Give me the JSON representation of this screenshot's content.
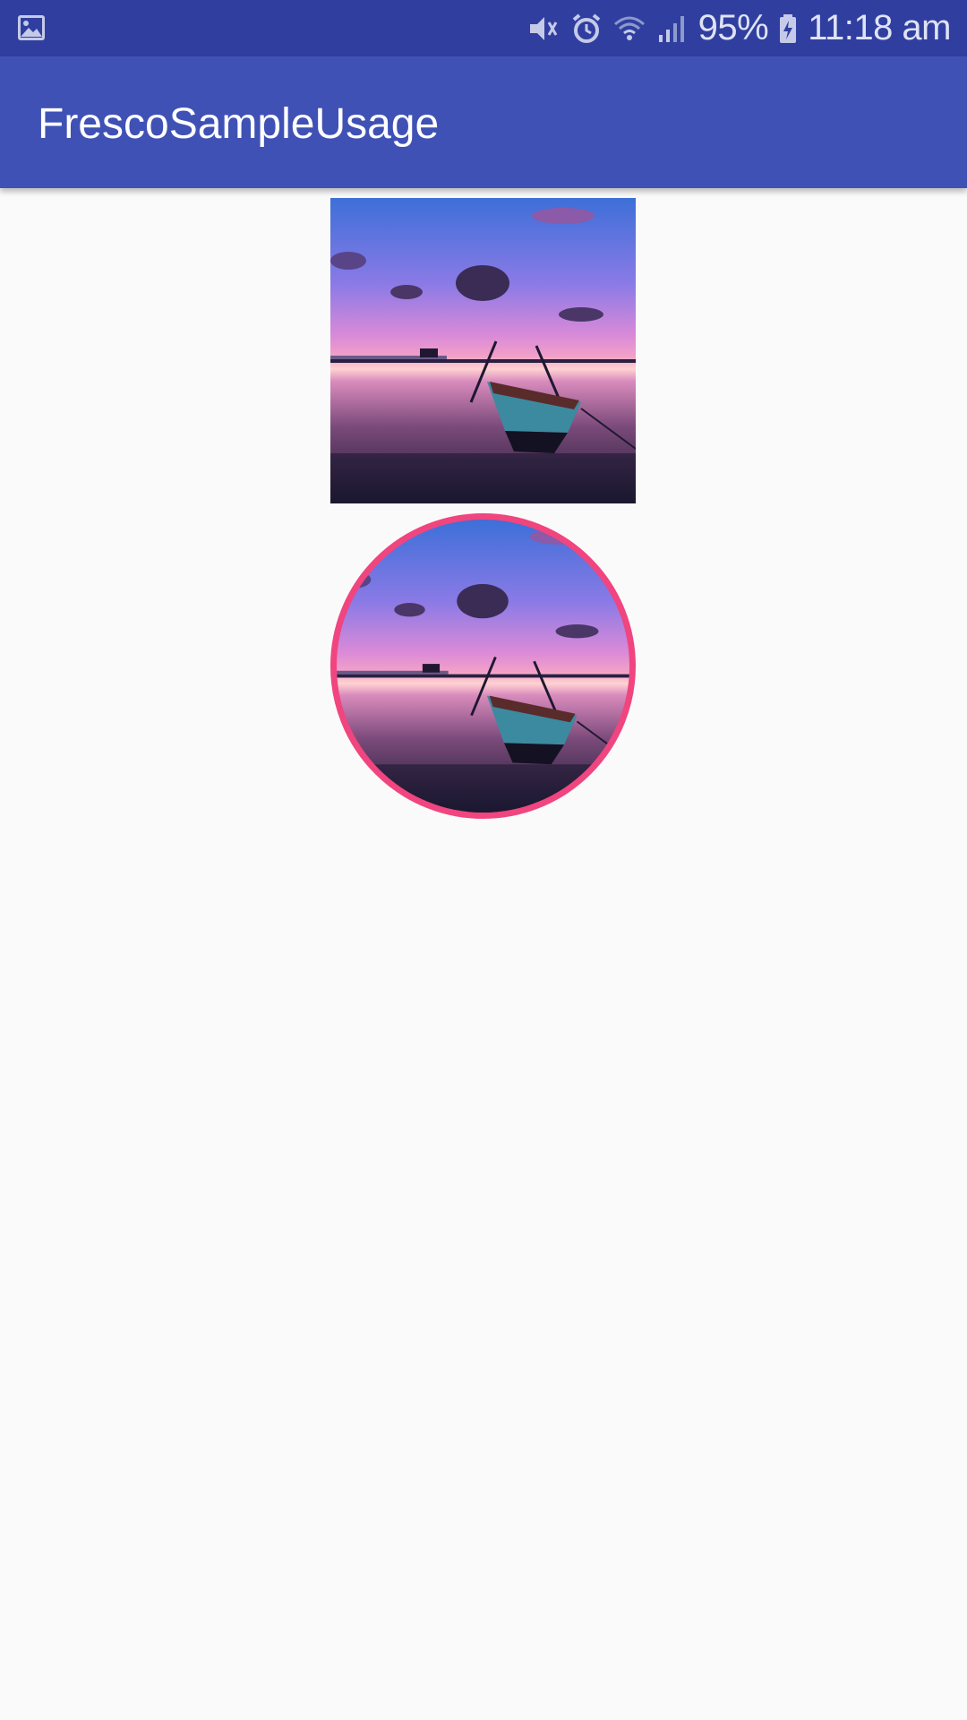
{
  "status_bar": {
    "left_icon": "image-icon",
    "icons": [
      "mute-icon",
      "alarm-icon",
      "wifi-icon",
      "signal-icon"
    ],
    "battery_percent": "95%",
    "battery_icon": "battery-charging-icon",
    "time": "11:18 am",
    "background_color": "#303f9f"
  },
  "app_bar": {
    "title": "FrescoSampleUsage",
    "background_color": "#3f51b5"
  },
  "content": {
    "images": [
      {
        "shape": "square",
        "subject": "sunset-boat-photo"
      },
      {
        "shape": "circle",
        "subject": "sunset-boat-photo",
        "border_color": "#f0457f"
      }
    ]
  }
}
